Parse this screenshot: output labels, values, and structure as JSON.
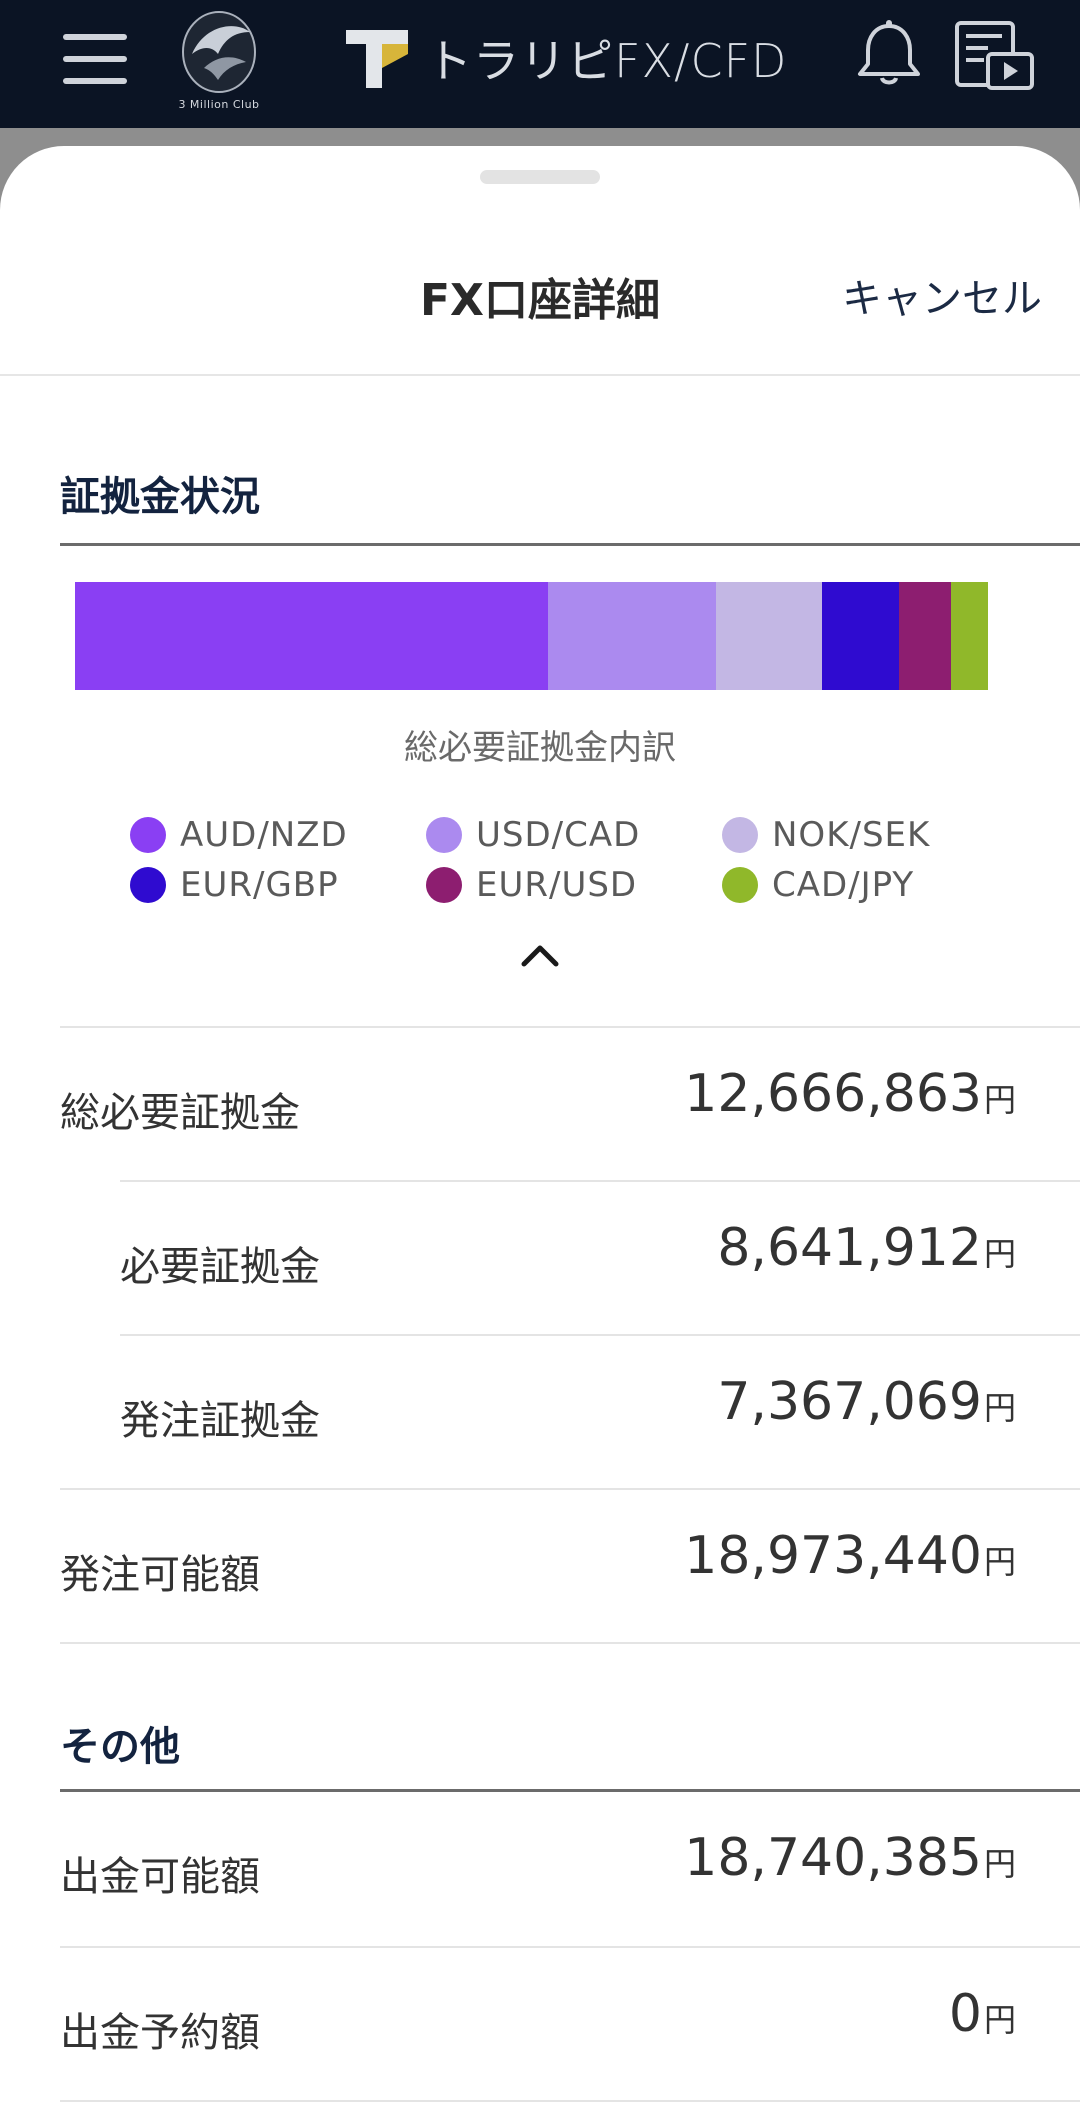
{
  "header": {
    "club_name": "3 Million Club",
    "brand_name": "トラリピFX/CFD"
  },
  "sheet": {
    "title": "FX口座詳細",
    "cancel_label": "キャンセル"
  },
  "margin_section": {
    "title": "証拠金状況",
    "breakdown_label": "総必要証拠金内訳"
  },
  "chart_data": {
    "type": "bar",
    "stacked": true,
    "title": "総必要証拠金内訳",
    "categories": [
      "AUD/NZD",
      "USD/CAD",
      "NOK/SEK",
      "EUR/GBP",
      "EUR/USD",
      "CAD/JPY"
    ],
    "values": [
      47.6,
      16.9,
      10.7,
      7.7,
      5.2,
      3.8
    ],
    "colors": [
      "#8a3ff3",
      "#ab8aef",
      "#c3b7e4",
      "#2f0bd0",
      "#8d1e70",
      "#90b82a"
    ]
  },
  "rows": [
    {
      "label": "総必要証拠金",
      "value": "12,666,863",
      "unit": "円"
    },
    {
      "label": "必要証拠金",
      "value": "8,641,912",
      "unit": "円"
    },
    {
      "label": "発注証拠金",
      "value": "7,367,069",
      "unit": "円"
    },
    {
      "label": "発注可能額",
      "value": "18,973,440",
      "unit": "円"
    }
  ],
  "other_section": {
    "title": "その他",
    "rows": [
      {
        "label": "出金可能額",
        "value": "18,740,385",
        "unit": "円"
      },
      {
        "label": "出金予約額",
        "value": "0",
        "unit": "円"
      }
    ]
  }
}
